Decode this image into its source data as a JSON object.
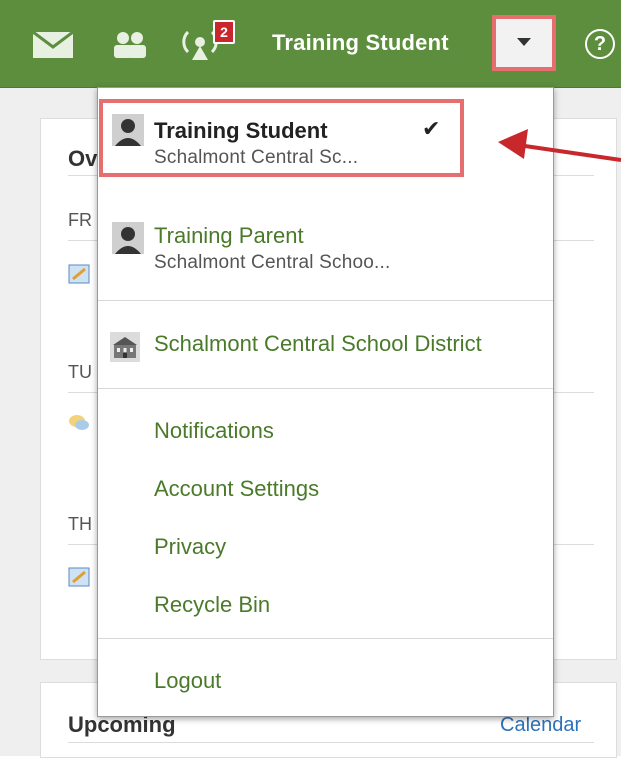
{
  "topbar": {
    "username": "Training Student",
    "notification_count": "2",
    "help_symbol": "?",
    "icons": [
      "mail-icon",
      "people-icon",
      "notifications-icon",
      "caret-down-icon",
      "help-icon"
    ]
  },
  "background": {
    "overview_title": "Ov",
    "days": [
      "FR",
      "TU",
      "TH"
    ],
    "upcoming_title": "Upcoming",
    "calendar_link": "Calendar"
  },
  "dropdown": {
    "current_account": {
      "name": "Training Student",
      "school": "Schalmont Central Sc...",
      "checkmark": "✔"
    },
    "other_account": {
      "name": "Training Parent",
      "school": "Schalmont Central Schoo..."
    },
    "district": "Schalmont Central School District",
    "links": [
      "Notifications",
      "Account Settings",
      "Privacy",
      "Recycle Bin"
    ],
    "logout": "Logout"
  },
  "colors": {
    "topbar_green": "#5c8e3e",
    "link_green": "#4a7a2a",
    "highlight_red": "#e56f6f",
    "arrow_red": "#c8282c",
    "badge_red": "#c8282c",
    "calendar_blue": "#2d73b8"
  }
}
